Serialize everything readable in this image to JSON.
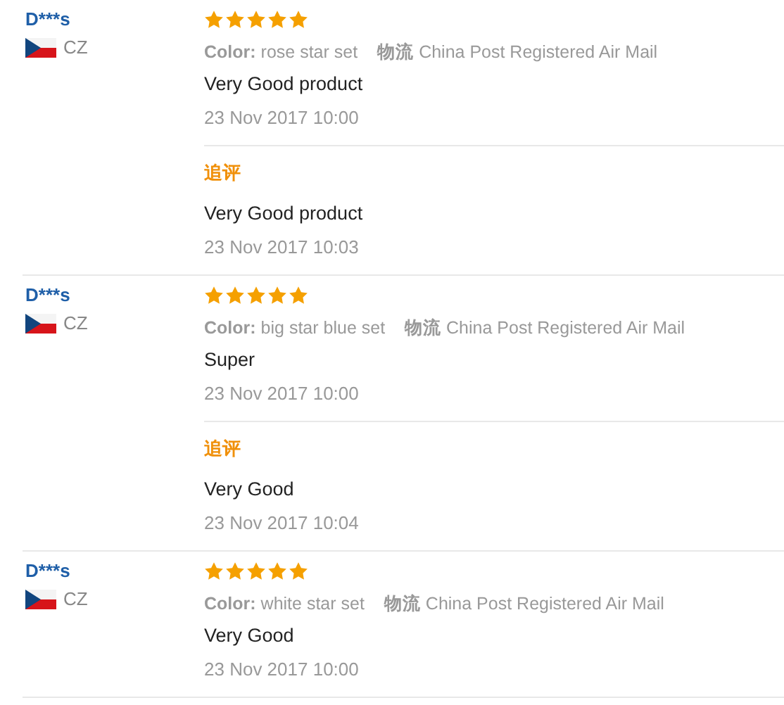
{
  "reviews": [
    {
      "user": "D***s",
      "country": "CZ",
      "stars": 5,
      "color_label": "Color:",
      "variant": "rose star set",
      "logistics_label": "物流",
      "logistics": "China Post Registered Air Mail",
      "text": "Very Good product",
      "date": "23 Nov 2017 10:00",
      "followup": {
        "label": "追评",
        "text": "Very Good product",
        "date": "23 Nov 2017 10:03"
      }
    },
    {
      "user": "D***s",
      "country": "CZ",
      "stars": 5,
      "color_label": "Color:",
      "variant": "big star blue set",
      "logistics_label": "物流",
      "logistics": "China Post Registered Air Mail",
      "text": "Super",
      "date": "23 Nov 2017 10:00",
      "followup": {
        "label": "追评",
        "text": "Very Good",
        "date": "23 Nov 2017 10:04"
      }
    },
    {
      "user": "D***s",
      "country": "CZ",
      "stars": 5,
      "color_label": "Color:",
      "variant": "white star set",
      "logistics_label": "物流",
      "logistics": "China Post Registered Air Mail",
      "text": "Very Good",
      "date": "23 Nov 2017 10:00"
    }
  ]
}
